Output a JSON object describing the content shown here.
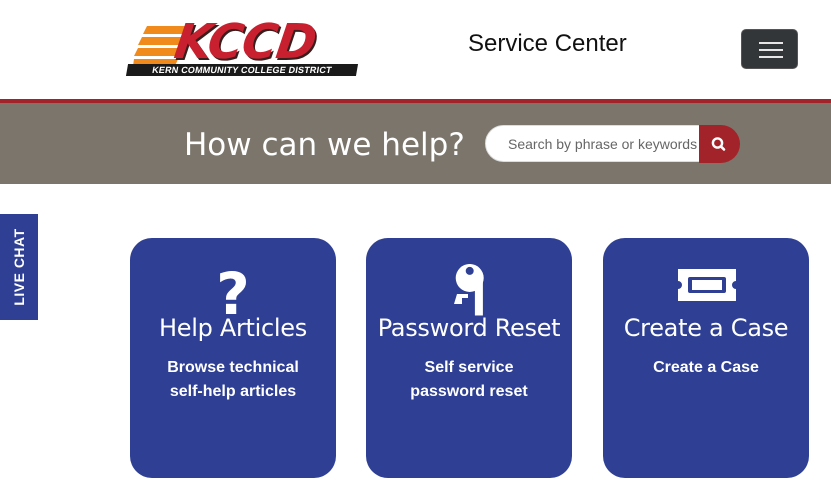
{
  "header": {
    "logo_text": "KCCD",
    "logo_subtext": "KERN COMMUNITY COLLEGE DISTRICT",
    "title": "Service Center",
    "menu_icon": "hamburger-icon"
  },
  "banner": {
    "heading": "How can we help?",
    "search_placeholder": "Search by phrase or keywords",
    "search_icon": "search-icon"
  },
  "live_chat": {
    "label": "LIVE CHAT"
  },
  "cards": [
    {
      "icon": "question-icon",
      "title": "Help Articles",
      "desc_line1": "Browse technical",
      "desc_line2": "self-help articles"
    },
    {
      "icon": "key-icon",
      "title": "Password Reset",
      "desc_line1": "Self service",
      "desc_line2": "password reset"
    },
    {
      "icon": "ticket-icon",
      "title": "Create a Case",
      "desc_line1": "Create a Case",
      "desc_line2": ""
    }
  ],
  "colors": {
    "brand_blue": "#2e3f94",
    "brand_red": "#a3232a",
    "banner_gray": "#7b756b",
    "logo_orange": "#f08a1c"
  }
}
